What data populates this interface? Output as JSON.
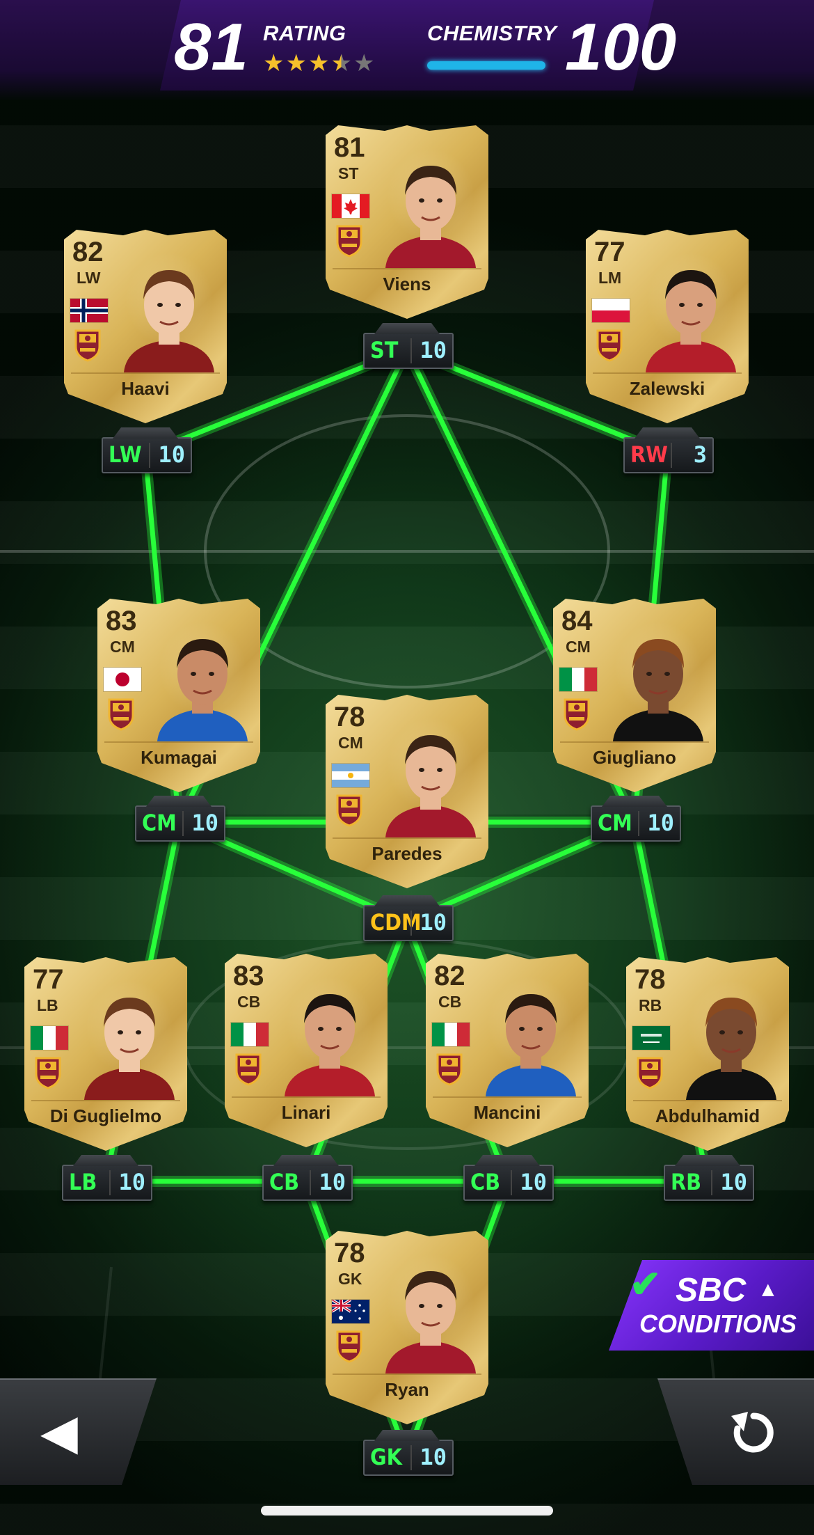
{
  "header": {
    "rating_value": "81",
    "rating_label": "RATING",
    "stars": [
      "full",
      "full",
      "full",
      "half",
      "empty"
    ],
    "chemistry_label": "CHEMISTRY",
    "chemistry_value": "100",
    "chemistry_fill": 1.0
  },
  "colors": {
    "link_green": "#28ff3a",
    "pos_green": "#33ff55",
    "pos_red": "#ff3b4a",
    "pos_yellow": "#ffc21a",
    "chem_cyan": "#9ff0ff",
    "card_gold": "#d9b458",
    "sbc_purple": "#6a22e0"
  },
  "players": [
    {
      "id": "st",
      "name": "Viens",
      "rating": "81",
      "pos": "ST",
      "flag": "canada",
      "slot_pos": "ST",
      "slot_chem": "10",
      "slot_color": "green"
    },
    {
      "id": "lw",
      "name": "Haavi",
      "rating": "82",
      "pos": "LW",
      "flag": "norway",
      "slot_pos": "LW",
      "slot_chem": "10",
      "slot_color": "green"
    },
    {
      "id": "lm",
      "name": "Zalewski",
      "rating": "77",
      "pos": "LM",
      "flag": "poland",
      "slot_pos": "RW",
      "slot_chem": "3",
      "slot_color": "red"
    },
    {
      "id": "lcm",
      "name": "Kumagai",
      "rating": "83",
      "pos": "CM",
      "flag": "japan",
      "slot_pos": "CM",
      "slot_chem": "10",
      "slot_color": "green"
    },
    {
      "id": "rcm",
      "name": "Giugliano",
      "rating": "84",
      "pos": "CM",
      "flag": "italy",
      "slot_pos": "CM",
      "slot_chem": "10",
      "slot_color": "green"
    },
    {
      "id": "cdm",
      "name": "Paredes",
      "rating": "78",
      "pos": "CM",
      "flag": "argentina",
      "slot_pos": "CDM",
      "slot_chem": "10",
      "slot_color": "yellow"
    },
    {
      "id": "lb",
      "name": "Di Guglielmo",
      "rating": "77",
      "pos": "LB",
      "flag": "italy",
      "slot_pos": "LB",
      "slot_chem": "10",
      "slot_color": "green"
    },
    {
      "id": "lcb",
      "name": "Linari",
      "rating": "83",
      "pos": "CB",
      "flag": "italy",
      "slot_pos": "CB",
      "slot_chem": "10",
      "slot_color": "green"
    },
    {
      "id": "rcb",
      "name": "Mancini",
      "rating": "82",
      "pos": "CB",
      "flag": "italy",
      "slot_pos": "CB",
      "slot_chem": "10",
      "slot_color": "green"
    },
    {
      "id": "rb",
      "name": "Abdulhamid",
      "rating": "78",
      "pos": "RB",
      "flag": "saudi-arabia",
      "slot_pos": "RB",
      "slot_chem": "10",
      "slot_color": "green"
    },
    {
      "id": "gk",
      "name": "Ryan",
      "rating": "78",
      "pos": "GK",
      "flag": "australia",
      "slot_pos": "GK",
      "slot_chem": "10",
      "slot_color": "green"
    }
  ],
  "sbc_button": {
    "line1": "SBC",
    "line2": "CONDITIONS",
    "check_icon": "checkmark-icon",
    "arrow_icon": "chevron-up-icon"
  },
  "nav": {
    "back_icon": "back-arrow-icon",
    "reset_icon": "reset-icon"
  },
  "club_crest_icon": "club-crest-icon"
}
